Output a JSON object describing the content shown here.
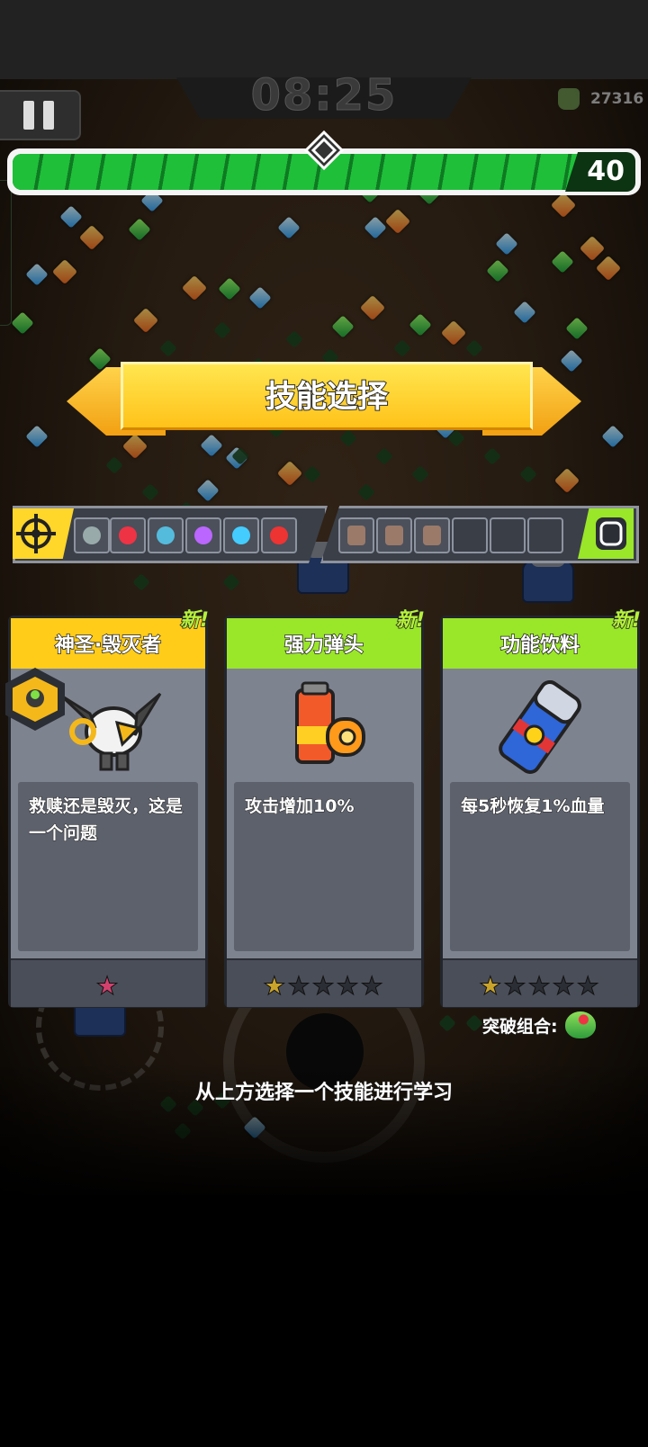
{
  "hud": {
    "timer": "08:25",
    "kill_count": "27316",
    "level": "40",
    "xp_progress": 0.91,
    "icons": {
      "pause": "pause-icon",
      "kills": "skull-icon",
      "level_marker": "diamond-marker-icon"
    }
  },
  "banner": {
    "title": "技能选择"
  },
  "skill_bar": {
    "active_icon": "crosshair-icon",
    "passive_icon": "gear-passive-icon",
    "active_slots": [
      "spin-drone-icon",
      "target-ring-icon",
      "cannon-icon",
      "potion-robot-icon",
      "shield-drone-icon",
      "boomerang-icon"
    ],
    "passive_slots": [
      "armor-icon",
      "boot-icon",
      "glove-icon",
      "",
      "",
      ""
    ]
  },
  "cards": [
    {
      "title": "神圣·毁灭者",
      "badge": "新!",
      "description": "救赎还是毁灭，这是一个问题",
      "icon": "robot-mech-icon",
      "stars_total": 1,
      "stars_filled": 0,
      "header_color": "#ffcc1a"
    },
    {
      "title": "强力弹头",
      "badge": "新!",
      "description": "攻击增加10%",
      "icon": "battery-bullet-icon",
      "stars_total": 5,
      "stars_filled": 1,
      "header_color": "#9ae629"
    },
    {
      "title": "功能饮料",
      "badge": "新!",
      "description": "每5秒恢复1%血量",
      "icon": "energy-drink-can-icon",
      "stars_total": 5,
      "stars_filled": 1,
      "header_color": "#9ae629"
    }
  ],
  "combo": {
    "label": "突破组合:",
    "icon": "watermelon-icon"
  },
  "hint": "从上方选择一个技能进行学习"
}
